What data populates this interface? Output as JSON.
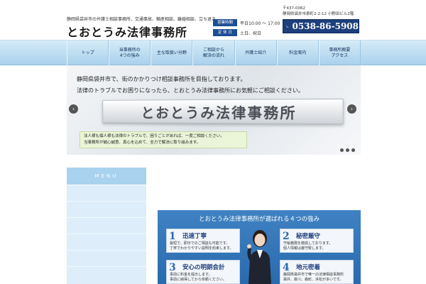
{
  "header": {
    "tagline": "静岡県袋井市の弁護士相談事務所、交通事故、頼産相談、離婚相談、立ち退き",
    "site_title": "とおとうみ法律事務所",
    "hours": [
      {
        "badge": "営業時間",
        "value": "平日10:00 ～ 17:00"
      },
      {
        "badge": "定 休 日",
        "value": "土日、祝日"
      }
    ],
    "zip": "〒437-0062",
    "address": "静岡県袋井市泉町2-2-12 小野田ビル2階",
    "phone": "0538-86-5908",
    "phone_icon": "phone-icon"
  },
  "nav": {
    "items": [
      "トップ",
      "当事務所の\n4つの強み",
      "主な取扱い分野",
      "ご相談から\n解決の流れ",
      "弁護士紹介",
      "料金案内",
      "事務所概要\nアクセス"
    ]
  },
  "slider": {
    "line1": "静岡県袋井市で、街のかかりつけ相談事務所を目指しております。",
    "line2": "法律のトラブルでお困りになったら、とおとうみ法律事務所にお気軽にご相談ください。",
    "sign": "とおとうみ法律事務所",
    "note1": "法人様も個人様も法律のトラブルで、困りごとがあれば、一度ご相談ください。",
    "note2": "当事務所が誠心誠意、真心を込めて、全力で解決に取り組みます。",
    "prev": "‹",
    "next": "›"
  },
  "sidebar": {
    "menu_label": "MENU"
  },
  "strengths": {
    "title": "とおとうみ法律事務所が選ばれる４つの強み",
    "cards": [
      {
        "num": "1",
        "title": "迅速丁寧",
        "text1": "最短で、即日でのご相談も可能です。",
        "text2": "丁寧でわかりやすい説明を約束します。"
      },
      {
        "num": "2",
        "title": "秘密厳守",
        "text1": "守秘義務を徹底しております。",
        "text2": "個人情報は厳守致します。"
      },
      {
        "num": "3",
        "title": "安心の明朗会計",
        "text1": "事前に料金を提示します。",
        "text2": "事前に納得してから依頼ください。"
      },
      {
        "num": "4",
        "title": "地元密着",
        "text1": "静岡県袋井市で唯一の法律相談事務所",
        "text2": "袋井、掛川、森町、浜松が多いです。"
      }
    ]
  }
}
